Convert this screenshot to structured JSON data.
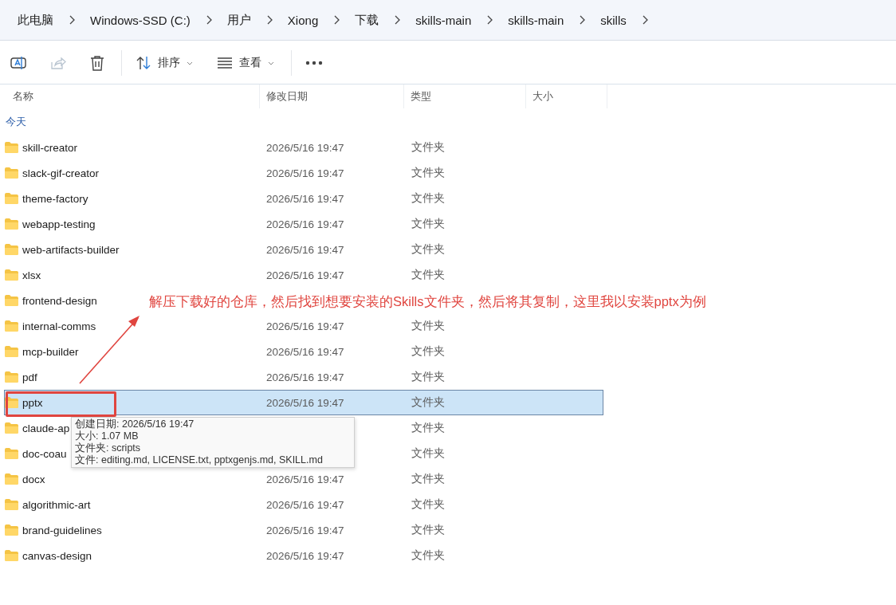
{
  "breadcrumbs": [
    "此电脑",
    "Windows-SSD (C:)",
    "用户",
    "Xiong",
    "下载",
    "skills-main",
    "skills-main",
    "skills"
  ],
  "toolbar": [
    {
      "kind": "rename",
      "disabled": false
    },
    {
      "kind": "share",
      "disabled": true
    },
    {
      "kind": "delete",
      "disabled": false
    },
    {
      "kind": "sort",
      "label": "排序",
      "disabled": false
    },
    {
      "kind": "view",
      "label": "查看",
      "disabled": false
    },
    {
      "kind": "more",
      "disabled": false
    }
  ],
  "columns": [
    "名称",
    "修改日期",
    "类型",
    "大小"
  ],
  "group": "今天",
  "rows": [
    {
      "name": "skill-creator",
      "date": "2026/5/16 19:47",
      "type": "文件夹",
      "selected": false
    },
    {
      "name": "slack-gif-creator",
      "date": "2026/5/16 19:47",
      "type": "文件夹",
      "selected": false
    },
    {
      "name": "theme-factory",
      "date": "2026/5/16 19:47",
      "type": "文件夹",
      "selected": false
    },
    {
      "name": "webapp-testing",
      "date": "2026/5/16 19:47",
      "type": "文件夹",
      "selected": false
    },
    {
      "name": "web-artifacts-builder",
      "date": "2026/5/16 19:47",
      "type": "文件夹",
      "selected": false
    },
    {
      "name": "xlsx",
      "date": "2026/5/16 19:47",
      "type": "文件夹",
      "selected": false
    },
    {
      "name": "frontend-design",
      "selected": false
    },
    {
      "name": "internal-comms",
      "date": "2026/5/16 19:47",
      "type": "文件夹",
      "selected": false
    },
    {
      "name": "mcp-builder",
      "date": "2026/5/16 19:47",
      "type": "文件夹",
      "selected": false
    },
    {
      "name": "pdf",
      "date": "2026/5/16 19:47",
      "type": "文件夹",
      "selected": false
    },
    {
      "name": "pptx",
      "date": "2026/5/16 19:47",
      "type": "文件夹",
      "selected": true
    },
    {
      "name": "claude-ap",
      "type": "文件夹",
      "selected": false
    },
    {
      "name": "doc-coau",
      "type": "文件夹",
      "selected": false
    },
    {
      "name": "docx",
      "date": "2026/5/16 19:47",
      "type": "文件夹",
      "selected": false
    },
    {
      "name": "algorithmic-art",
      "date": "2026/5/16 19:47",
      "type": "文件夹",
      "selected": false
    },
    {
      "name": "brand-guidelines",
      "date": "2026/5/16 19:47",
      "type": "文件夹",
      "selected": false
    },
    {
      "name": "canvas-design",
      "date": "2026/5/16 19:47",
      "type": "文件夹",
      "selected": false
    }
  ],
  "annotation": "解压下载好的仓库，然后找到想要安装的Skills文件夹，然后将其复制，这里我以安装pptx为例",
  "tooltip": [
    "创建日期: 2026/5/16 19:47",
    "大小: 1.07 MB",
    "文件夹: scripts",
    "文件: editing.md, LICENSE.txt, pptxgenjs.md, SKILL.md"
  ]
}
